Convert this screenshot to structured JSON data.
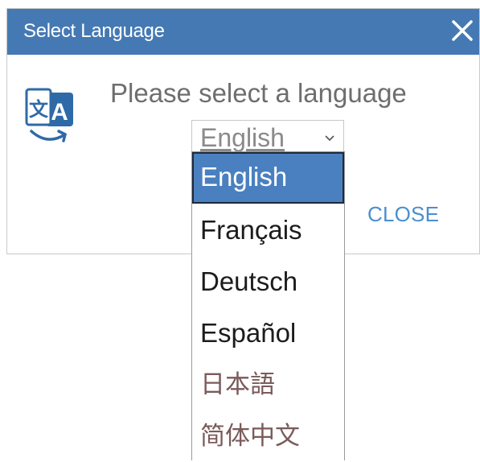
{
  "dialog": {
    "title": "Select Language",
    "prompt": "Please select a language",
    "close_link": "CLOSE",
    "close_icon": "close-x-icon",
    "language_icon": "translate-icon"
  },
  "select": {
    "value": "English"
  },
  "dropdown": {
    "options": [
      {
        "label": "English",
        "selected": true
      },
      {
        "label": "Français",
        "selected": false
      },
      {
        "label": "Deutsch",
        "selected": false
      },
      {
        "label": "Español",
        "selected": false
      },
      {
        "label": "日本語",
        "selected": false
      },
      {
        "label": "简体中文",
        "selected": false
      }
    ]
  },
  "colors": {
    "titlebar": "#4579b3",
    "link": "#4a8fcf",
    "selected_option": "#4a80c0"
  }
}
